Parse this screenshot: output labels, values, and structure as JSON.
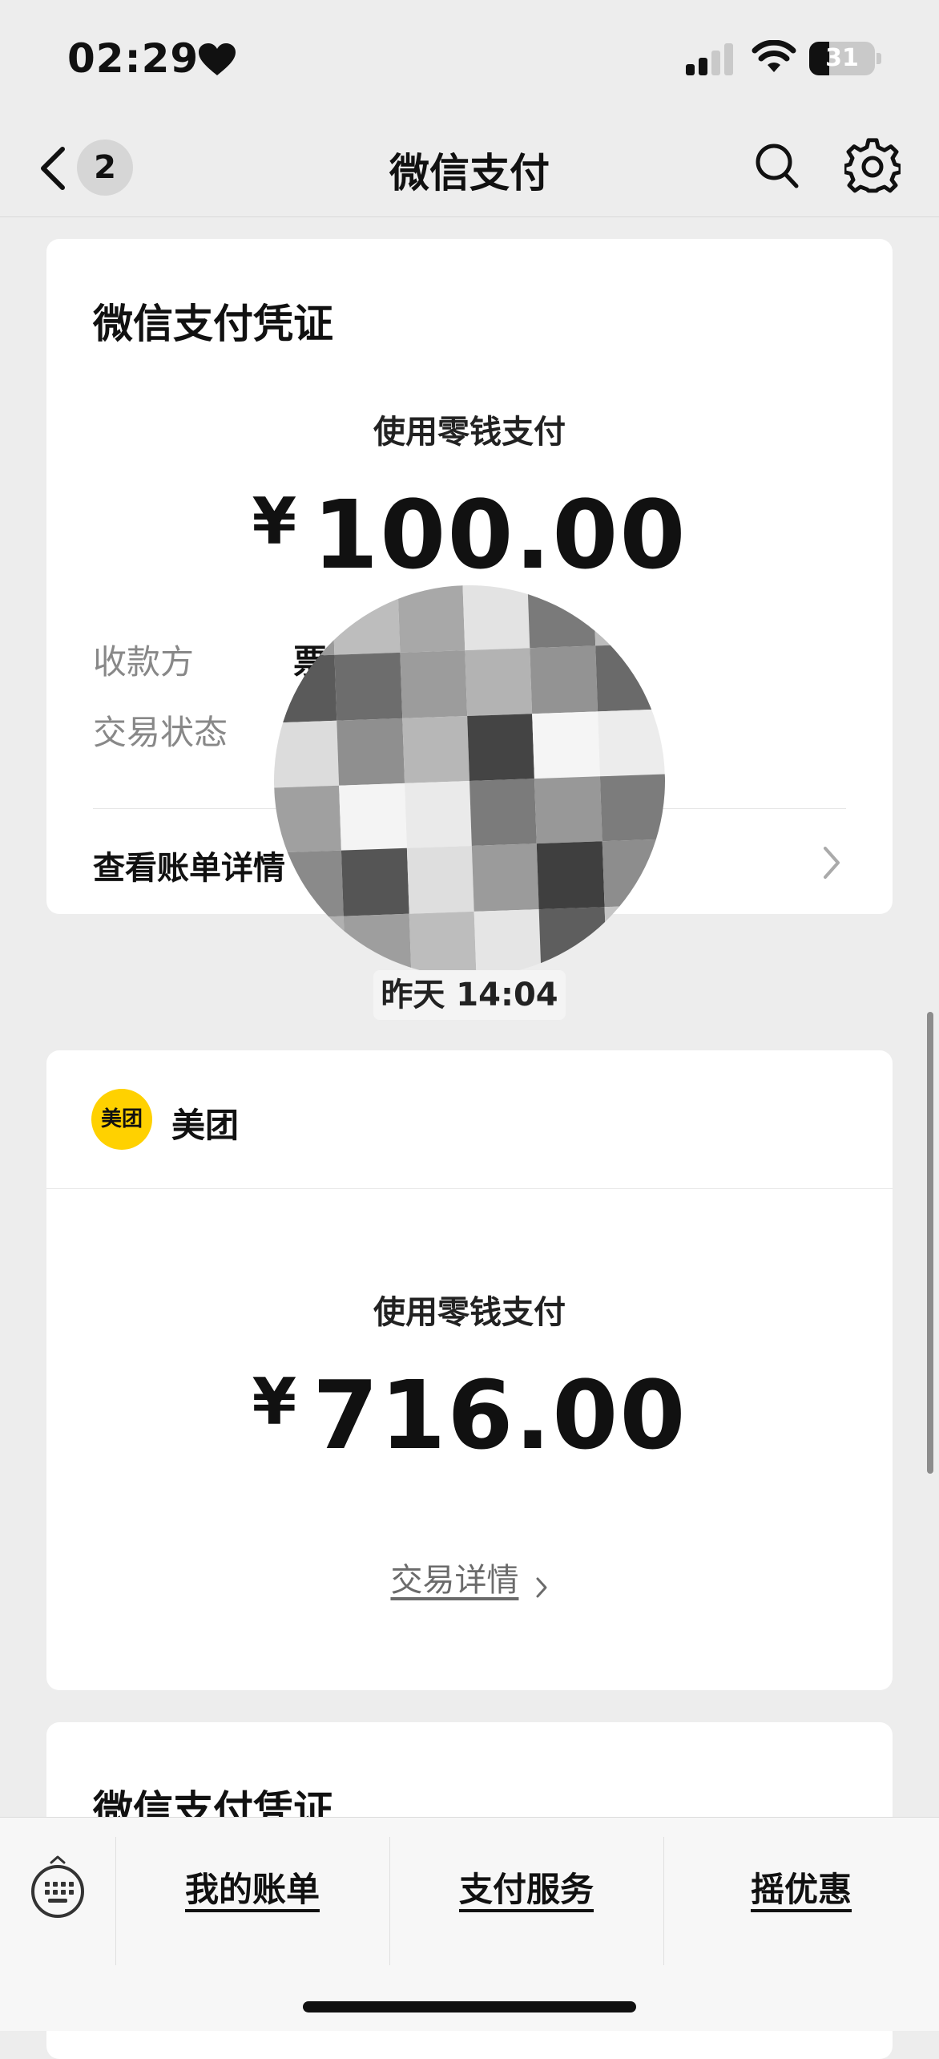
{
  "status_bar": {
    "time": "02:29",
    "battery": "31",
    "battery_level": 0.31
  },
  "nav": {
    "back_badge": "2",
    "title": "微信支付"
  },
  "card1": {
    "title": "微信支付凭证",
    "pay_method": "使用零钱支付",
    "currency": "¥",
    "amount": "100.00",
    "payee_label": "收款方",
    "payee_value_visible": "票",
    "status_label": "交易状态",
    "view_details": "查看账单详情"
  },
  "timestamp": "昨天 14:04",
  "card2": {
    "merchant_logo_text": "美团",
    "merchant": "美团",
    "pay_method": "使用零钱支付",
    "currency": "¥",
    "amount": "716.00",
    "details_link": "交易详情"
  },
  "card3": {
    "title": "微信支付凭证"
  },
  "bottom_bar": {
    "tabs": [
      {
        "label": "我的账单"
      },
      {
        "label": "支付服务"
      },
      {
        "label": "摇优惠"
      }
    ]
  },
  "colors": {
    "meituan_yellow": "#ffd100",
    "background": "#ededed",
    "card": "#ffffff"
  },
  "icons": [
    "heart-icon",
    "signal-icon",
    "wifi-icon",
    "back-icon",
    "search-icon",
    "gear-icon",
    "chevron-right-icon",
    "keyboard-icon"
  ]
}
